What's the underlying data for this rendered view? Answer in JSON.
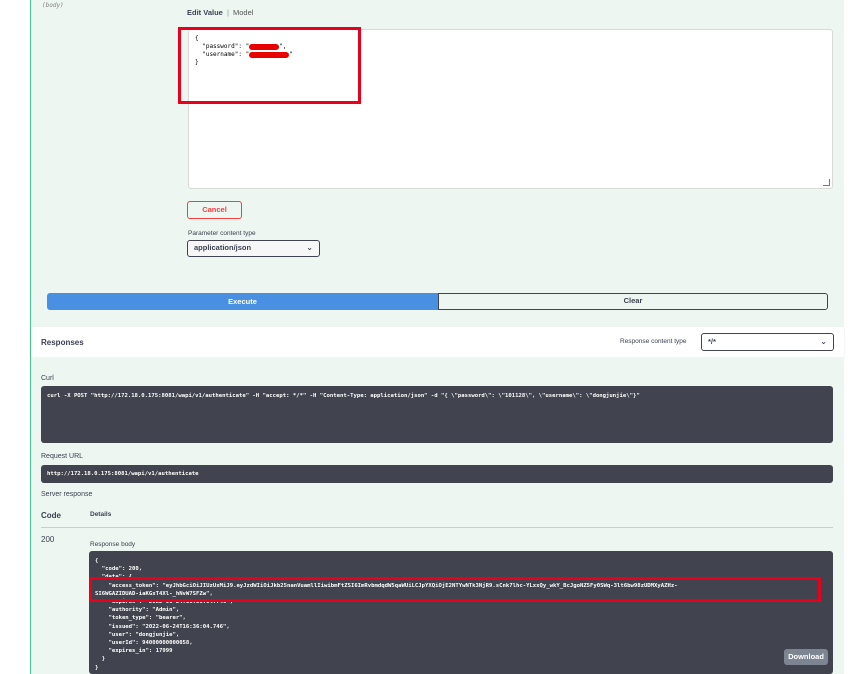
{
  "request": {
    "body_tag": "(body)",
    "tabs": {
      "edit_value": "Edit Value",
      "separator": "|",
      "model": "Model"
    },
    "body_lines": {
      "open": "{",
      "password_key": "  \"password\": \"",
      "password_end": "\",",
      "username_key": "  \"username\": \"",
      "username_end": "\"",
      "close": "}"
    },
    "cancel_label": "Cancel",
    "parameter_content_type_label": "Parameter content type",
    "parameter_content_type_value": "application/json",
    "execute_label": "Execute",
    "clear_label": "Clear"
  },
  "responses": {
    "title": "Responses",
    "content_type_label": "Response content type",
    "content_type_value": "*/*",
    "curl_label": "Curl",
    "curl_command": "curl -X POST \"http://172.18.0.175:8081/wapi/v1/authenticate\" -H \"accept: */*\" -H \"Content-Type: application/json\" -d \"{ \\\"password\\\": \\\"101128\\\", \\\"username\\\": \\\"dongjunjie\\\"}\"",
    "request_url_label": "Request URL",
    "request_url": "http://172.18.0.175:8081/wapi/v1/authenticate",
    "server_response_label": "Server response",
    "code_header": "Code",
    "details_header": "Details",
    "status_code": "200",
    "response_body_label": "Response body",
    "response_body_lines": [
      "{",
      "  \"code\": 200,",
      "  \"data\": {",
      "    \"access_token\": \"eyJhbGciOiJIUzUxMiJ9.eyJzdWIiOiJkb25nanVuamllIiwibmFtZSI6ImRvbmdqdW5qaWUiLCJpYXQiOjE2NTYwNTk3NjR9.sCnk7lhc-YLxxQy_wkY_BcJgoNZ5Fy0SWq-3lt6bw98zUDMXyAZHz-",
      "SI6WGAZIDUAD-iaKGxT4Xl-_hNvW7SFZw\",",
      "    \"expires\": \"2022-06-24T16:36:04.746\",",
      "    \"authority\": \"Admin\",",
      "    \"token_type\": \"bearer\",",
      "    \"issued\": \"2022-06-24T16:36:04.746\",",
      "    \"user\": \"dongjunjie\",",
      "    \"userId\": 94000000000058,",
      "    \"expires_in\": 17999",
      "  }",
      "}"
    ],
    "download_label": "Download"
  },
  "colors": {
    "operation_background": "#edf6f1",
    "operation_border": "#49cc90",
    "execute_blue": "#4990e2",
    "cancel_red": "#f93e3e",
    "dark_code_block": "#41444e",
    "annotation_red": "#e8001c"
  }
}
